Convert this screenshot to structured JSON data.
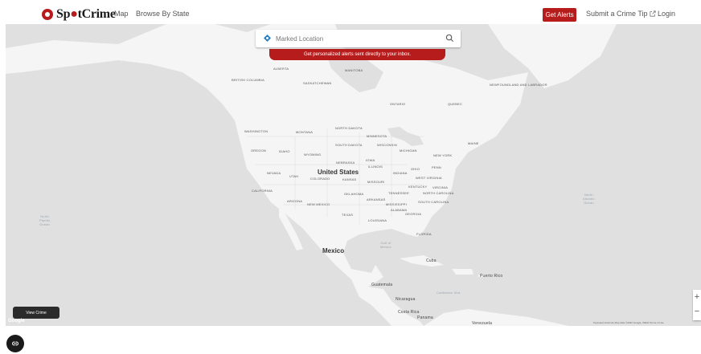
{
  "header": {
    "logo_part1": "Sp",
    "logo_part2": "tCrime",
    "nav_map": "Map",
    "nav_browse": "Browse By State",
    "get_alerts": "Get Alerts",
    "submit_tip": "Submit a Crime Tip",
    "login": "Login"
  },
  "search": {
    "placeholder": "Marked Location"
  },
  "banner": {
    "text": "Get personalized alerts sent directly to your inbox."
  },
  "map": {
    "labels": {
      "us": "United States",
      "mexico": "Mexico",
      "cuba": "Cuba",
      "guatemala": "Guatemala",
      "nicaragua": "Nicaragua",
      "costa_rica": "Costa Rica",
      "panama": "Panama",
      "venezuela": "Venezuela",
      "puerto_rico": "Puerto Rico",
      "alberta": "ALBERTA",
      "manitoba": "MANITOBA",
      "saskatchewan": "SASKATCHEWAN",
      "british_columbia": "BRITISH\nCOLUMBIA",
      "ontario": "ONTARIO",
      "quebec": "QUEBEC",
      "newfoundland": "NEWFOUNDLAND\nAND LABRADOR",
      "washington": "WASHINGTON",
      "montana": "MONTANA",
      "north_dakota": "NORTH\nDAKOTA",
      "minnesota": "MINNESOTA",
      "oregon": "OREGON",
      "idaho": "IDAHO",
      "wyoming": "WYOMING",
      "south_dakota": "SOUTH\nDAKOTA",
      "wisconsin": "WISCONSIN",
      "michigan": "MICHIGAN",
      "new_york": "NEW YORK",
      "maine": "MAINE",
      "nebraska": "NEBRASKA",
      "iowa": "IOWA",
      "illinois": "ILLINOIS",
      "ohio": "OHIO",
      "penn": "PENN",
      "nevada": "NEVADA",
      "utah": "UTAH",
      "colorado": "COLORADO",
      "kansas": "KANSAS",
      "missouri": "MISSOURI",
      "indiana": "INDIANA",
      "west_virginia": "WEST\nVIRGINIA",
      "kentucky": "KENTUCKY",
      "virginia": "VIRGINIA",
      "california": "CALIFORNIA",
      "arizona": "ARIZONA",
      "new_mexico": "NEW MEXICO",
      "oklahoma": "OKLAHOMA",
      "arkansas": "ARKANSAS",
      "tennessee": "TENNESSEE",
      "north_carolina": "NORTH\nCAROLINA",
      "south_carolina": "SOUTH\nCAROLINA",
      "mississippi": "MISSISSIPPI",
      "alabama": "ALABAMA",
      "georgia": "GEORGIA",
      "texas": "TEXAS",
      "louisiana": "LOUISIANA",
      "florida": "FLORIDA",
      "north_pacific": "North\nPacific\nOcean",
      "north_atlantic": "North\nAtlantic\nOcean",
      "gulf": "Gulf of\nMexico",
      "caribbean": "Caribbean Sea"
    },
    "view_crime": "View Crime",
    "google": "Google",
    "attribution": "Keyboard shortcuts   Map data ©2022 Google, INEGI   Terms of Use",
    "zoom_in": "+",
    "zoom_out": "−"
  },
  "colors": {
    "brand_red": "#b71c1c",
    "land": "#f5f5f5",
    "water": "#e0e0e0"
  }
}
